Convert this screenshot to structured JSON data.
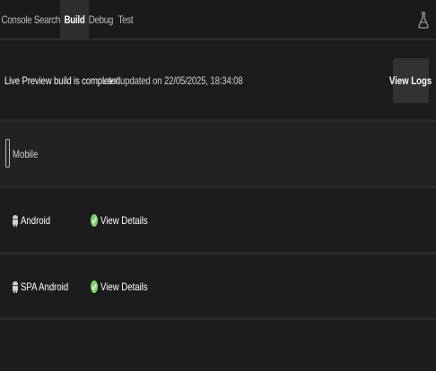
{
  "tabs": [
    {
      "label": "Console"
    },
    {
      "label": "Search"
    },
    {
      "label": "Build",
      "active": true
    },
    {
      "label": "Debug"
    },
    {
      "label": "Test"
    }
  ],
  "toolbar": {
    "right_icon": "flask-icon"
  },
  "build": {
    "status": "Live Preview build is completed.",
    "last_updated": "Last updated on 22/05/2025, 18:34:08",
    "view_logs_label": "View Logs"
  },
  "section": {
    "label": "Mobile",
    "icon": "mobile-phone-icon"
  },
  "platforms": [
    {
      "label": "Android",
      "link": "View Details",
      "icon": "android-icon",
      "status_icon": "check-circle-icon"
    },
    {
      "label": "SPA Android",
      "link": "View Details",
      "icon": "android-icon",
      "status_icon": "check-circle-icon"
    }
  ],
  "colors": {
    "success": "#7ed36b",
    "background": "#1c1c1e",
    "button": "#323234"
  }
}
